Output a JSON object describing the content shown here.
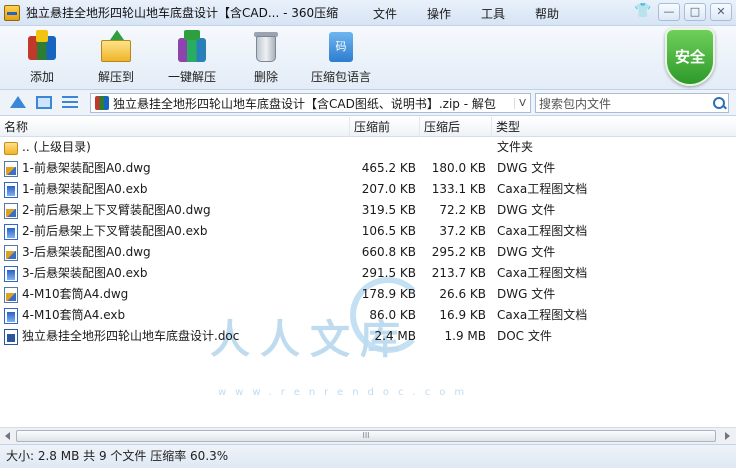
{
  "window": {
    "title": "独立悬挂全地形四轮山地车底盘设计【含CAD... - 360压缩"
  },
  "menu": [
    "文件",
    "操作",
    "工具",
    "帮助"
  ],
  "window_controls": {
    "skin": "👕",
    "minimize": "—",
    "maximize": "□",
    "close": "✕"
  },
  "toolbar": {
    "add": "添加",
    "extract_to": "解压到",
    "one_click_extract": "一键解压",
    "delete": "删除",
    "language": "压缩包语言",
    "language_icon_glyph": "码"
  },
  "security_badge": "安全",
  "address": {
    "path": "独立悬挂全地形四轮山地车底盘设计【含CAD图纸、说明书】.zip - 解包",
    "dropdown": "V",
    "search_placeholder": "搜索包内文件"
  },
  "columns": {
    "name": "名称",
    "original_size": "压缩前",
    "compressed_size": "压缩后",
    "type": "类型"
  },
  "files": [
    {
      "name": ".. (上级目录)",
      "orig": "",
      "comp": "",
      "type": "文件夹",
      "icon": "folder-icon"
    },
    {
      "name": "1-前悬架装配图A0.dwg",
      "orig": "465.2 KB",
      "comp": "180.0 KB",
      "type": "DWG 文件",
      "icon": "dwg-file-icon"
    },
    {
      "name": "1-前悬架装配图A0.exb",
      "orig": "207.0 KB",
      "comp": "133.1 KB",
      "type": "Caxa工程图文档",
      "icon": "exb-file-icon"
    },
    {
      "name": "2-前后悬架上下叉臂装配图A0.dwg",
      "orig": "319.5 KB",
      "comp": "72.2 KB",
      "type": "DWG 文件",
      "icon": "dwg-file-icon"
    },
    {
      "name": "2-前后悬架上下叉臂装配图A0.exb",
      "orig": "106.5 KB",
      "comp": "37.2 KB",
      "type": "Caxa工程图文档",
      "icon": "exb-file-icon"
    },
    {
      "name": "3-后悬架装配图A0.dwg",
      "orig": "660.8 KB",
      "comp": "295.2 KB",
      "type": "DWG 文件",
      "icon": "dwg-file-icon"
    },
    {
      "name": "3-后悬架装配图A0.exb",
      "orig": "291.5 KB",
      "comp": "213.7 KB",
      "type": "Caxa工程图文档",
      "icon": "exb-file-icon"
    },
    {
      "name": "4-M10套筒A4.dwg",
      "orig": "178.9 KB",
      "comp": "26.6 KB",
      "type": "DWG 文件",
      "icon": "dwg-file-icon"
    },
    {
      "name": "4-M10套筒A4.exb",
      "orig": "86.0 KB",
      "comp": "16.9 KB",
      "type": "Caxa工程图文档",
      "icon": "exb-file-icon"
    },
    {
      "name": "独立悬挂全地形四轮山地车底盘设计.doc",
      "orig": "2.4 MB",
      "comp": "1.9 MB",
      "type": "DOC 文件",
      "icon": "doc-file-icon"
    }
  ],
  "watermark": {
    "text": "人人文库",
    "url": "www.renrendoc.com"
  },
  "scrollbar": {
    "grip": "III"
  },
  "status": "大小: 2.8 MB 共 9 个文件 压缩率 60.3%"
}
